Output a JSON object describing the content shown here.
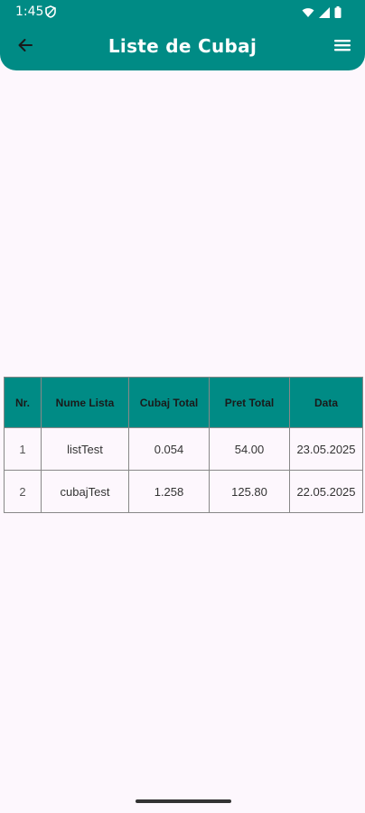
{
  "status_bar": {
    "time": "1:45"
  },
  "toolbar": {
    "title": "Liste de Cubaj",
    "back_icon": "arrow-left-icon",
    "menu_icon": "hamburger-menu-icon"
  },
  "colors": {
    "primary": "#008b85",
    "background": "#fdf7fd"
  },
  "table": {
    "headers": [
      "Nr.",
      "Nume Lista",
      "Cubaj Total",
      "Pret Total",
      "Data"
    ],
    "rows": [
      {
        "nr": "1",
        "name": "listTest",
        "cubaj": "0.054",
        "pret": "54.00",
        "data": "23.05.2025"
      },
      {
        "nr": "2",
        "name": "cubajTest",
        "cubaj": "1.258",
        "pret": "125.80",
        "data": "22.05.2025"
      }
    ]
  }
}
